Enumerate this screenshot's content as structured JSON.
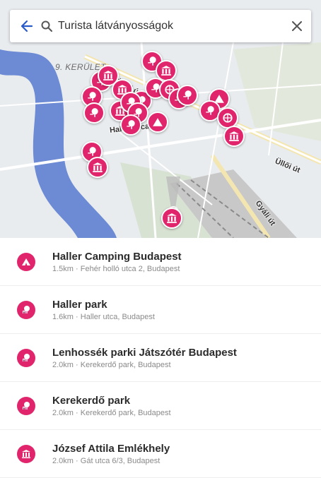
{
  "search": {
    "query": "Turista látványosságok"
  },
  "map": {
    "district_label": "9. KERÜLET",
    "streets": [
      "Üllői út",
      "Haller utca",
      "Üllői út",
      "Gyáli út"
    ]
  },
  "results": [
    {
      "title": "Haller Camping Budapest",
      "distance": "1.5km",
      "address": "Fehér holló utca 2, Budapest",
      "icon": "camping-icon"
    },
    {
      "title": "Haller park",
      "distance": "1.6km",
      "address": "Haller utca, Budapest",
      "icon": "park-icon"
    },
    {
      "title": "Lenhossék parki Játszótér Budapest",
      "distance": "2.0km",
      "address": "Kerekerdő park, Budapest",
      "icon": "park-icon"
    },
    {
      "title": "Kerekerdő park",
      "distance": "2.0km",
      "address": "Kerekerdő park, Budapest",
      "icon": "park-icon"
    },
    {
      "title": "József Attila Emlékhely",
      "distance": "2.0km",
      "address": "Gát utca 6/3, Budapest",
      "icon": "museum-icon"
    }
  ],
  "separator": "·",
  "colors": {
    "accent": "#e0256c",
    "river": "#6c8bd4",
    "park": "#c9dcc3"
  }
}
